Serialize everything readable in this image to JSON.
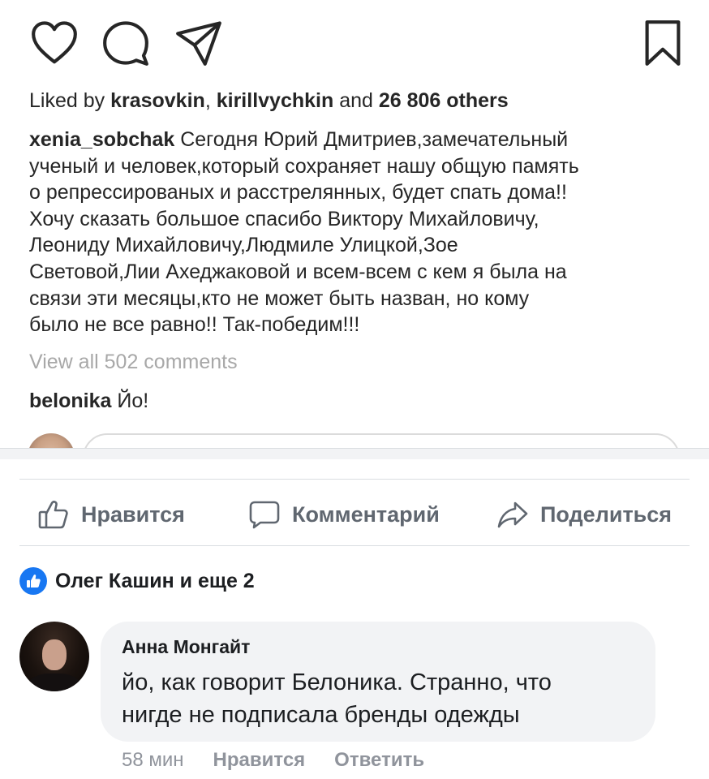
{
  "instagram": {
    "icons": {
      "like": "heart-icon",
      "comment": "comment-bubble-icon",
      "share": "paper-plane-icon",
      "save": "bookmark-icon"
    },
    "likes": {
      "prefix": "Liked by ",
      "user1": "krasovkin",
      "separator": ", ",
      "user2": "kirillvychkin",
      "middle": " and ",
      "count": "26 806 others"
    },
    "caption": {
      "username": "xenia_sobchak",
      "lines": [
        " Сегодня Юрий Дмитриев,замечательный",
        "ученый и человек,который сохраняет нашу общую память",
        "о репрессированых и расстрелянных, будет спать дома!!",
        "Хочу сказать большое спасибо Виктору Михайловичу,",
        "Леониду Михайловичу,Людмиле Улицкой,Зое",
        "Световой,Лии Ахеджаковой  и всем-всем с кем я была на",
        "связи эти месяцы,кто не может быть назван,  но кому",
        "было не все равно!! Так-победим!!!"
      ]
    },
    "view_all_comments": "View all 502 comments",
    "top_comment": {
      "username": "belonika",
      "text": " Йо!"
    }
  },
  "facebook": {
    "actions": {
      "like": "Нравится",
      "comment": "Комментарий",
      "share": "Поделиться"
    },
    "reactions": {
      "text": "Олег Кашин и еще 2"
    },
    "comment": {
      "author": "Анна Монгайт",
      "lines": [
        "йо, как говорит Белоника. Странно, что",
        "нигде не подписала бренды одежды"
      ],
      "time": "58 мин",
      "like_label": "Нравится",
      "reply_label": "Ответить"
    },
    "colors": {
      "accent": "#1877f2",
      "muted_text": "#606770",
      "bubble_bg": "#f2f3f5"
    }
  }
}
